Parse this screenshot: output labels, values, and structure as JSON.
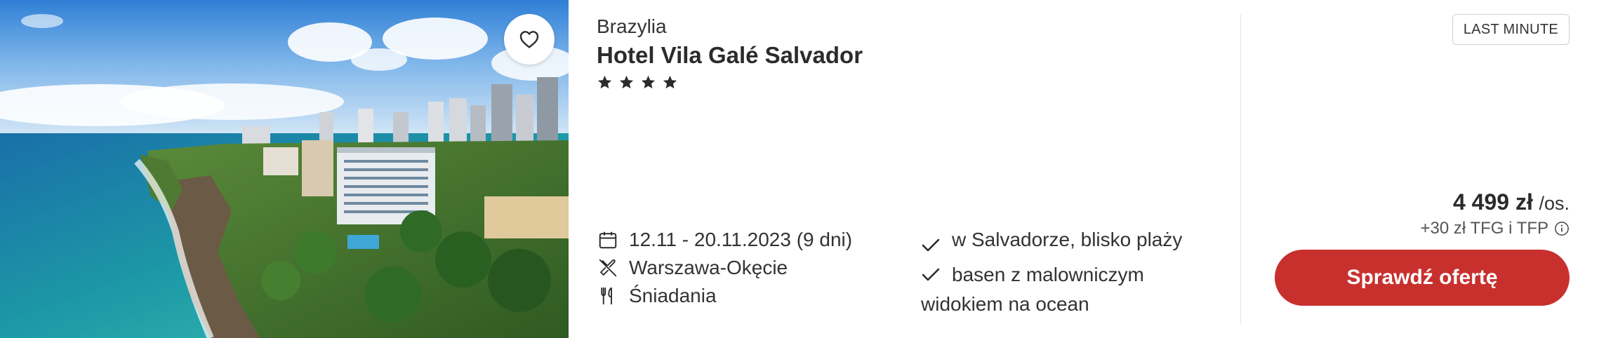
{
  "image": {
    "alt": "Hotel Vila Galé Salvador"
  },
  "favorite": {
    "icon": "heart-outline-icon"
  },
  "hotel": {
    "country": "Brazylia",
    "name": "Hotel Vila Galé Salvador",
    "stars": 4
  },
  "details": {
    "dates": "12.11 - 20.11.2023 (9 dni)",
    "departure": "Warszawa-Okęcie",
    "board": "Śniadania",
    "icons": [
      "calendar-icon",
      "plane-icon",
      "fork-knife-icon"
    ]
  },
  "features": [
    {
      "text": "w Salvadorze, blisko plaży"
    },
    {
      "text": "basen z malowniczym widokiem na ocean"
    }
  ],
  "offer": {
    "badge": "LAST MINUTE",
    "price": "4 499 zł",
    "per": "/os.",
    "fees": "+30 zł TFG i TFP",
    "button": "Sprawdź ofertę",
    "accent": "#c8302e"
  }
}
